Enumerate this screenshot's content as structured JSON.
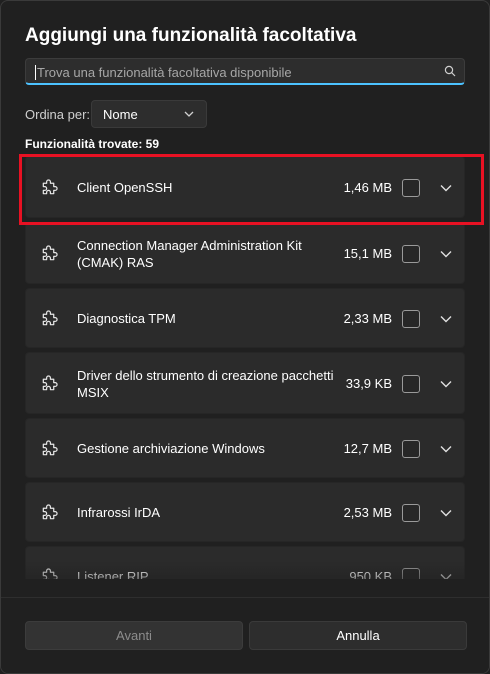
{
  "dialog": {
    "title": "Aggiungi una funzionalità facoltativa",
    "search_placeholder": "Trova una funzionalità facoltativa disponibile",
    "sort_label": "Ordina per:",
    "sort_value": "Nome",
    "count_label": "Funzionalità trovate: 59"
  },
  "features": [
    {
      "name": "Client OpenSSH",
      "size": "1,46 MB",
      "checked": false
    },
    {
      "name": "Connection Manager Administration Kit (CMAK) RAS",
      "size": "15,1 MB",
      "checked": false
    },
    {
      "name": "Diagnostica TPM",
      "size": "2,33 MB",
      "checked": false
    },
    {
      "name": "Driver dello strumento di creazione pacchetti MSIX",
      "size": "33,9 KB",
      "checked": false
    },
    {
      "name": "Gestione archiviazione Windows",
      "size": "12,7 MB",
      "checked": false
    },
    {
      "name": "Infrarossi IrDA",
      "size": "2,53 MB",
      "checked": false
    },
    {
      "name": "Listener RIP",
      "size": "950 KB",
      "checked": false
    }
  ],
  "footer": {
    "next_label": "Avanti",
    "cancel_label": "Annulla"
  },
  "icons": {
    "feature": "puzzle-piece-icon",
    "search": "search-icon",
    "expand": "chevron-down-icon"
  },
  "colors": {
    "accent": "#4cc2ff",
    "highlight_box": "#e81123"
  }
}
